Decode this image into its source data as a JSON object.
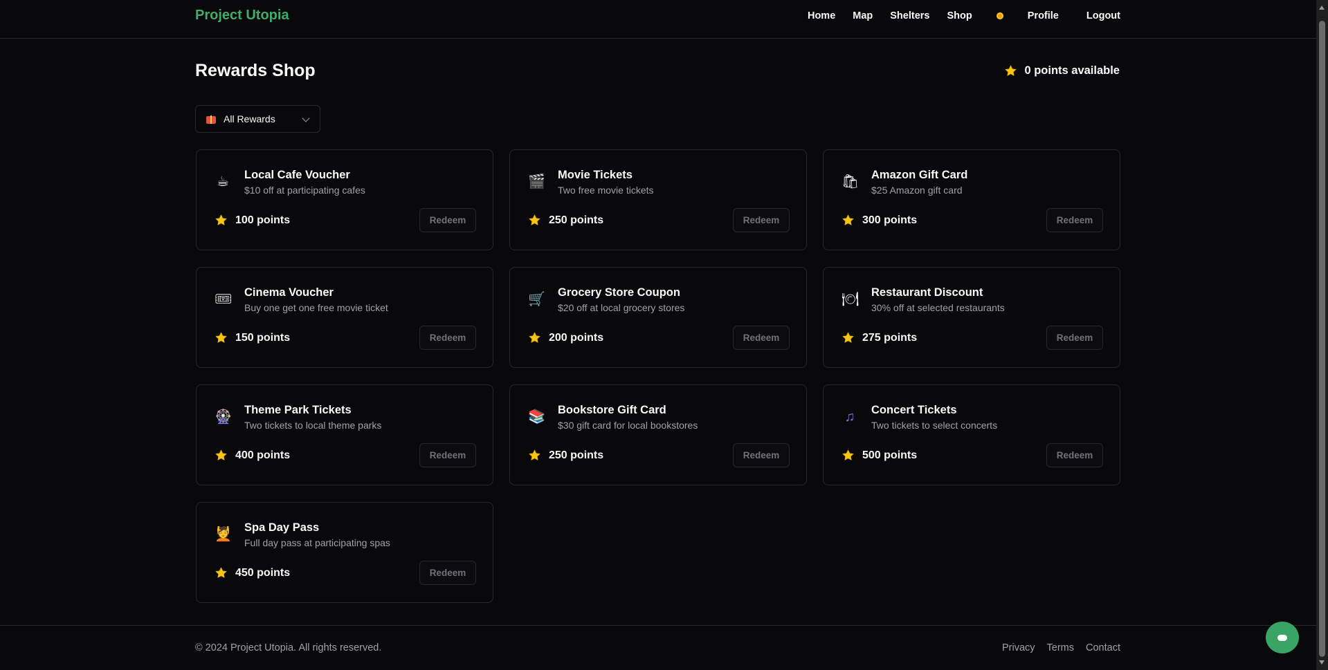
{
  "header": {
    "brand": "Project Utopia",
    "nav": {
      "home": "Home",
      "map": "Map",
      "shelters": "Shelters",
      "shop": "Shop",
      "profile": "Profile",
      "logout": "Logout"
    }
  },
  "page": {
    "title": "Rewards Shop",
    "points_available": "0 points available"
  },
  "filter": {
    "selected": "All Rewards"
  },
  "rewards": [
    {
      "name": "Local Cafe Voucher",
      "description": "$10 off at participating cafes",
      "points": "100 points",
      "button": "Redeem",
      "icon": "coffee-icon"
    },
    {
      "name": "Movie Tickets",
      "description": "Two free movie tickets",
      "points": "250 points",
      "button": "Redeem",
      "icon": "clapperboard-icon"
    },
    {
      "name": "Amazon Gift Card",
      "description": "$25 Amazon gift card",
      "points": "300 points",
      "button": "Redeem",
      "icon": "shopping-bags-icon"
    },
    {
      "name": "Cinema Voucher",
      "description": "Buy one get one free movie ticket",
      "points": "150 points",
      "button": "Redeem",
      "icon": "ticket-icon"
    },
    {
      "name": "Grocery Store Coupon",
      "description": "$20 off at local grocery stores",
      "points": "200 points",
      "button": "Redeem",
      "icon": "shopping-cart-icon"
    },
    {
      "name": "Restaurant Discount",
      "description": "30% off at selected restaurants",
      "points": "275 points",
      "button": "Redeem",
      "icon": "plate-cutlery-icon"
    },
    {
      "name": "Theme Park Tickets",
      "description": "Two tickets to local theme parks",
      "points": "400 points",
      "button": "Redeem",
      "icon": "ferris-wheel-icon"
    },
    {
      "name": "Bookstore Gift Card",
      "description": "$30 gift card for local bookstores",
      "points": "250 points",
      "button": "Redeem",
      "icon": "books-icon"
    },
    {
      "name": "Concert Tickets",
      "description": "Two tickets to select concerts",
      "points": "500 points",
      "button": "Redeem",
      "icon": "music-note-icon"
    },
    {
      "name": "Spa Day Pass",
      "description": "Full day pass at participating spas",
      "points": "450 points",
      "button": "Redeem",
      "icon": "spa-person-icon"
    }
  ],
  "footer": {
    "copyright": "© 2024 Project Utopia. All rights reserved.",
    "links": {
      "privacy": "Privacy",
      "terms": "Terms",
      "contact": "Contact"
    }
  },
  "colors": {
    "background": "#09090b",
    "brand": "#3fae6a",
    "star": "#f5c518",
    "border": "#27272a",
    "muted_text": "#a1a1aa",
    "chat_button": "#3aa366"
  }
}
